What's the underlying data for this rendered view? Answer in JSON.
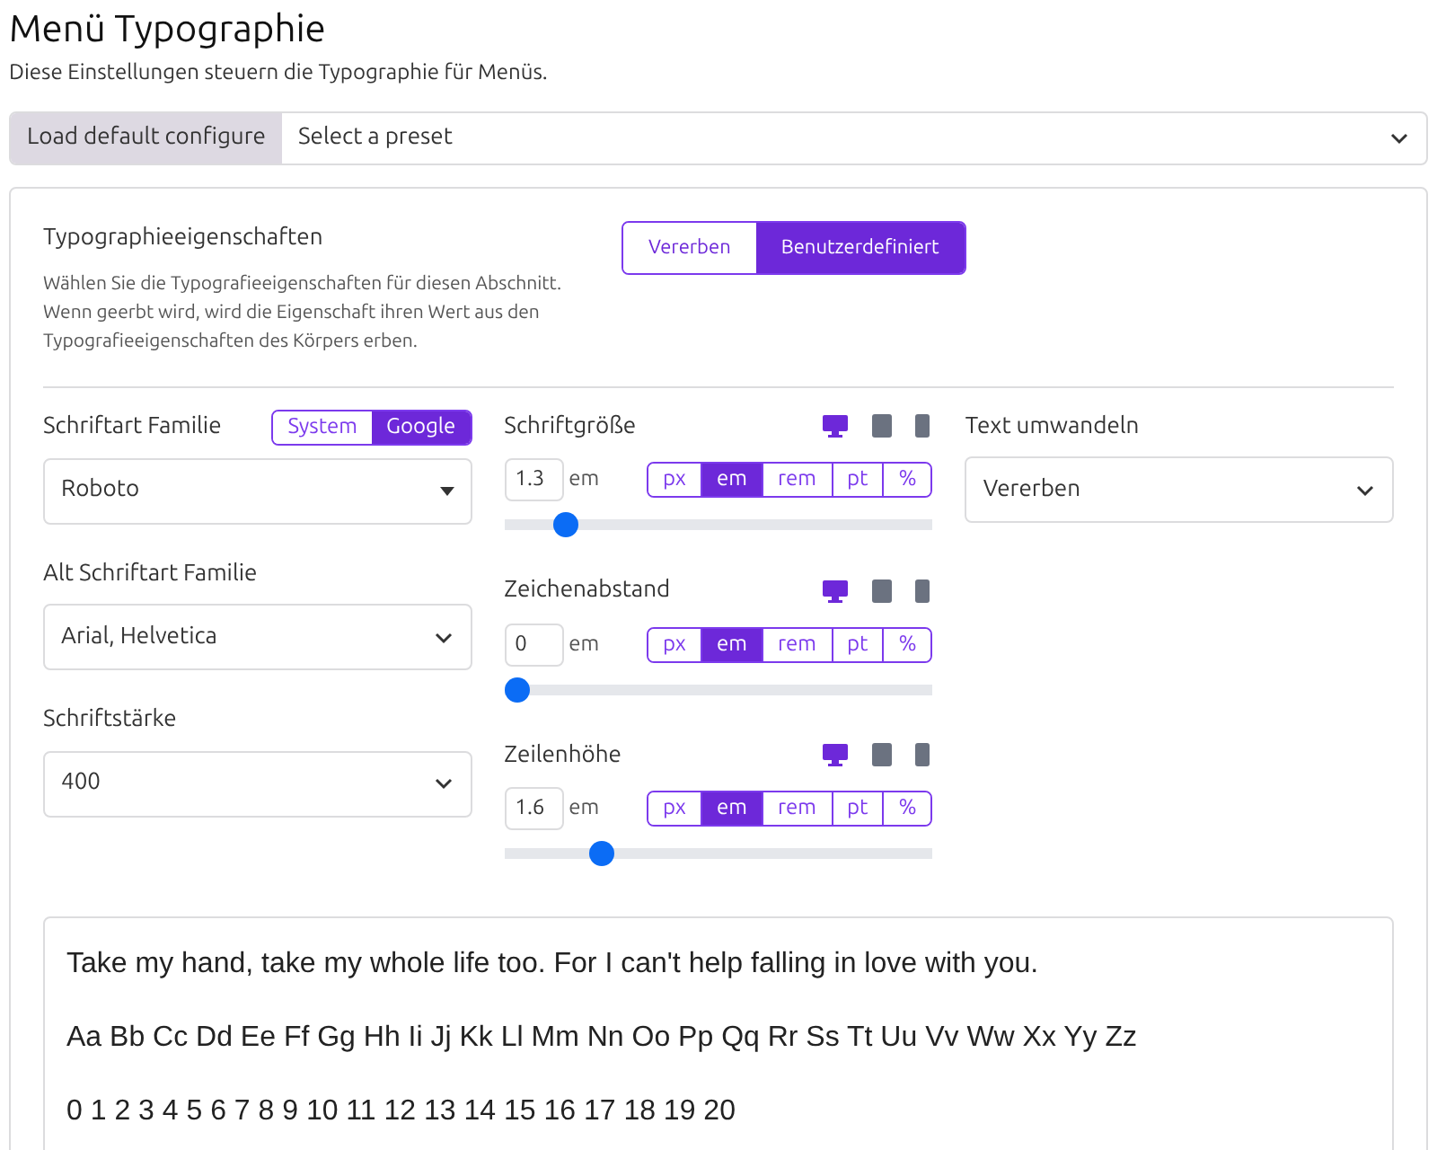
{
  "title": "Menü Typographie",
  "subtitle": "Diese Einstellungen steuern die Typographie für Menüs.",
  "preset": {
    "button": "Load default configure",
    "placeholder": "Select a preset"
  },
  "properties": {
    "label": "Typographieeigenschaften",
    "description": "Wählen Sie die Typografieeigenschaften für diesen Abschnitt. Wenn geerbt wird, wird die Eigenschaft ihren Wert aus den Typografieeigenschaften des Körpers erben.",
    "options": [
      {
        "label": "Vererben",
        "selected": false
      },
      {
        "label": "Benutzerdefiniert",
        "selected": true
      }
    ]
  },
  "font_family": {
    "label": "Schriftart Familie",
    "sources": [
      {
        "label": "System",
        "selected": false
      },
      {
        "label": "Google",
        "selected": true
      }
    ],
    "value": "Roboto"
  },
  "alt_font_family": {
    "label": "Alt Schriftart Familie",
    "value": "Arial, Helvetica"
  },
  "font_weight": {
    "label": "Schriftstärke",
    "value": "400"
  },
  "sliders": [
    {
      "label": "Schriftgröße",
      "value": "1.3",
      "unit": "em",
      "level": 0.12,
      "devices": [
        {
          "kind": "desktop",
          "selected": true
        },
        {
          "kind": "tablet",
          "selected": false
        },
        {
          "kind": "mobile",
          "selected": false
        }
      ],
      "units": [
        {
          "label": "px",
          "selected": false
        },
        {
          "label": "em",
          "selected": true
        },
        {
          "label": "rem",
          "selected": false
        },
        {
          "label": "pt",
          "selected": false
        },
        {
          "label": "%",
          "selected": false
        }
      ]
    },
    {
      "label": "Zeichenabstand",
      "value": "0",
      "unit": "em",
      "level": 0,
      "devices": [
        {
          "kind": "desktop",
          "selected": true
        },
        {
          "kind": "tablet",
          "selected": false
        },
        {
          "kind": "mobile",
          "selected": false
        }
      ],
      "units": [
        {
          "label": "px",
          "selected": false
        },
        {
          "label": "em",
          "selected": true
        },
        {
          "label": "rem",
          "selected": false
        },
        {
          "label": "pt",
          "selected": false
        },
        {
          "label": "%",
          "selected": false
        }
      ]
    },
    {
      "label": "Zeilenhöhe",
      "value": "1.6",
      "unit": "em",
      "level": 0.21,
      "devices": [
        {
          "kind": "desktop",
          "selected": true
        },
        {
          "kind": "tablet",
          "selected": false
        },
        {
          "kind": "mobile",
          "selected": false
        }
      ],
      "units": [
        {
          "label": "px",
          "selected": false
        },
        {
          "label": "em",
          "selected": true
        },
        {
          "label": "rem",
          "selected": false
        },
        {
          "label": "pt",
          "selected": false
        },
        {
          "label": "%",
          "selected": false
        }
      ]
    }
  ],
  "text_transform": {
    "label": "Text umwandeln",
    "value": "Vererben"
  },
  "preview": [
    "Take my hand, take my whole life too. For I can't help falling in love with you.",
    "Aa Bb Cc Dd Ee Ff Gg Hh Ii Jj Kk Ll Mm Nn Oo Pp Qq Rr Ss Tt Uu Vv Ww Xx Yy Zz",
    "0 1 2 3 4 5 6 7 8 9 10 11 12 13 14 15 16 17 18 19 20"
  ]
}
